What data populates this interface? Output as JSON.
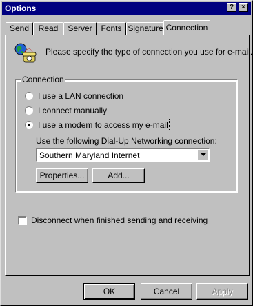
{
  "window": {
    "title": "Options",
    "help_label": "?",
    "close_label": "×"
  },
  "tabs": [
    {
      "label": "Send"
    },
    {
      "label": "Read"
    },
    {
      "label": "Server"
    },
    {
      "label": "Fonts"
    },
    {
      "label": "Signature"
    },
    {
      "label": "Connection",
      "active": true
    }
  ],
  "connection_tab": {
    "intro_text": "Please specify the type of connection you use for e-mail.",
    "group_title": "Connection",
    "options": [
      {
        "label": "I use a LAN connection",
        "selected": false
      },
      {
        "label": "I connect manually",
        "selected": false
      },
      {
        "label": "I use a modem to access my e-mail",
        "selected": true
      }
    ],
    "dialup_label": "Use the following Dial-Up Networking connection:",
    "dialup_selected": "Southern Maryland Internet",
    "properties_button": "Properties...",
    "add_button": "Add...",
    "disconnect_label": "Disconnect when finished sending and receiving",
    "disconnect_checked": false
  },
  "footer": {
    "ok": "OK",
    "cancel": "Cancel",
    "apply": "Apply"
  },
  "colors": {
    "titlebar": "#000080",
    "face": "#c0c0c0"
  },
  "icons": {
    "connection": "globe-with-phone-icon"
  }
}
